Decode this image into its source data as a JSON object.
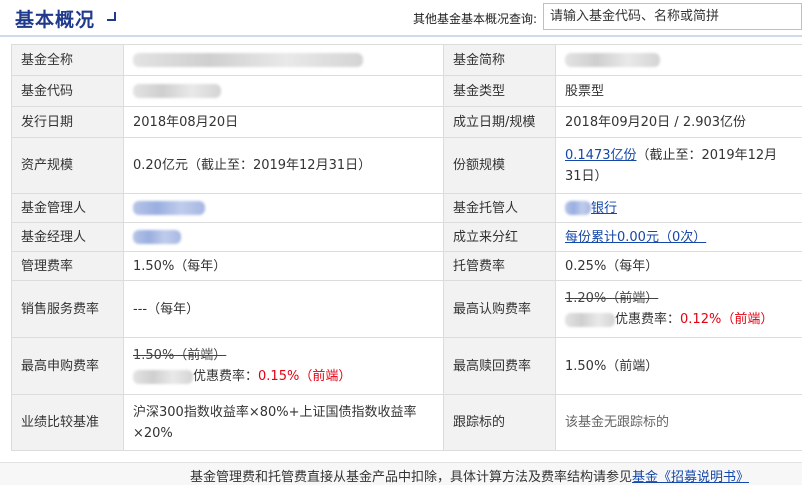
{
  "header": {
    "title": "基本概况",
    "query_label": "其他基金基本概况查询:",
    "search_placeholder": "请输入基金代码、名称或简拼"
  },
  "table": {
    "full_name": {
      "label": "基金全称"
    },
    "short_name": {
      "label": "基金简称"
    },
    "code": {
      "label": "基金代码"
    },
    "type": {
      "label": "基金类型",
      "value": "股票型"
    },
    "issue_date": {
      "label": "发行日期",
      "value": "2018年08月20日"
    },
    "establish": {
      "label": "成立日期/规模",
      "value": "2018年09月20日 / 2.903亿份"
    },
    "asset_scale": {
      "label": "资产规模",
      "value": "0.20亿元（截止至：2019年12月31日）"
    },
    "share_scale": {
      "label": "份额规模",
      "link": "0.1473亿份",
      "suffix": "（截止至：2019年12月31日）"
    },
    "manager": {
      "label": "基金管理人"
    },
    "custodian": {
      "label": "基金托管人",
      "link_suffix": "银行"
    },
    "fund_manager": {
      "label": "基金经理人"
    },
    "dividend": {
      "label": "成立来分红",
      "link": "每份累计0.00元（0次）"
    },
    "mgmt_fee": {
      "label": "管理费率",
      "value": "1.50%（每年）"
    },
    "custody_fee": {
      "label": "托管费率",
      "value": "0.25%（每年）"
    },
    "sales_fee": {
      "label": "销售服务费率",
      "value": "---（每年）"
    },
    "max_subscribe": {
      "label": "最高认购费率",
      "original": "1.20%（前端）",
      "discount_prefix": "优惠费率：",
      "discount_value": "0.12%（前端）"
    },
    "max_purchase": {
      "label": "最高申购费率",
      "original": "1.50%（前端）",
      "discount_prefix": "优惠费率：",
      "discount_value": "0.15%（前端）"
    },
    "max_redeem": {
      "label": "最高赎回费率",
      "value": "1.50%（前端）"
    },
    "benchmark": {
      "label": "业绩比较基准",
      "value": "沪深300指数收益率×80%+上证国债指数收益率×20%"
    },
    "tracking": {
      "label": "跟踪标的",
      "value": "该基金无跟踪标的"
    }
  },
  "footer": {
    "text": "基金管理费和托管费直接从基金产品中扣除，具体计算方法及费率结构请参见",
    "link": "基金《招募说明书》"
  }
}
